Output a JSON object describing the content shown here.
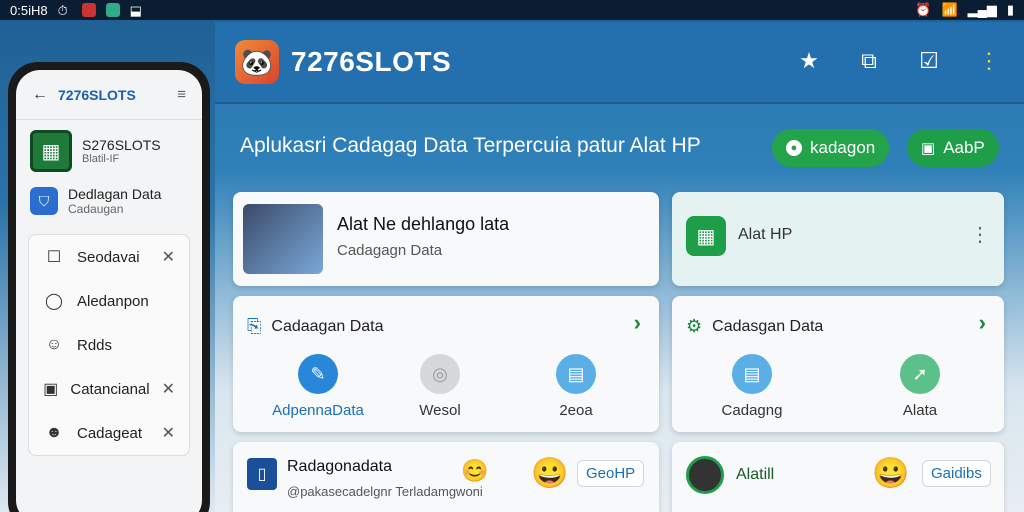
{
  "statusbar": {
    "time": "0:5iH8",
    "right_text": ""
  },
  "header": {
    "title": "7276SLOTS"
  },
  "subtitle": "Aplukasri Cadagag Data Terpercuia patur Alat HP",
  "pills": [
    {
      "label": "kadagon"
    },
    {
      "label": "AabP"
    }
  ],
  "featured": {
    "title": "Alat Ne dehlango lata",
    "subtitle": "Cadagagn Data"
  },
  "alat_card": {
    "label": "Alat HP"
  },
  "section_left": {
    "title": "Cadaagan Data",
    "items": [
      {
        "label": "AdpennaData"
      },
      {
        "label": "Wesol"
      },
      {
        "label": "2eoa"
      }
    ]
  },
  "section_right": {
    "title": "Cadasgan Data",
    "items": [
      {
        "label": "Cadagng"
      },
      {
        "label": "Alata"
      }
    ]
  },
  "bottom_left": {
    "title": "Radagonadata",
    "subtitle": "@pakasecadelgnr Terladamgwoni",
    "button": "GeoHP"
  },
  "bottom_right": {
    "title": "Alatill",
    "button": "Gaidibs"
  },
  "phone": {
    "title": "7276SLOTS",
    "app_name": "S276SLOTS",
    "app_sub": "Blatil-IF",
    "backup": {
      "title": "Dedlagan Data",
      "sub": "Cadaugan"
    },
    "list": [
      {
        "label": "Seodavai"
      },
      {
        "label": "Aledanpon"
      },
      {
        "label": "Rdds"
      },
      {
        "label": "Catancianal"
      },
      {
        "label": "Cadageat"
      }
    ]
  }
}
